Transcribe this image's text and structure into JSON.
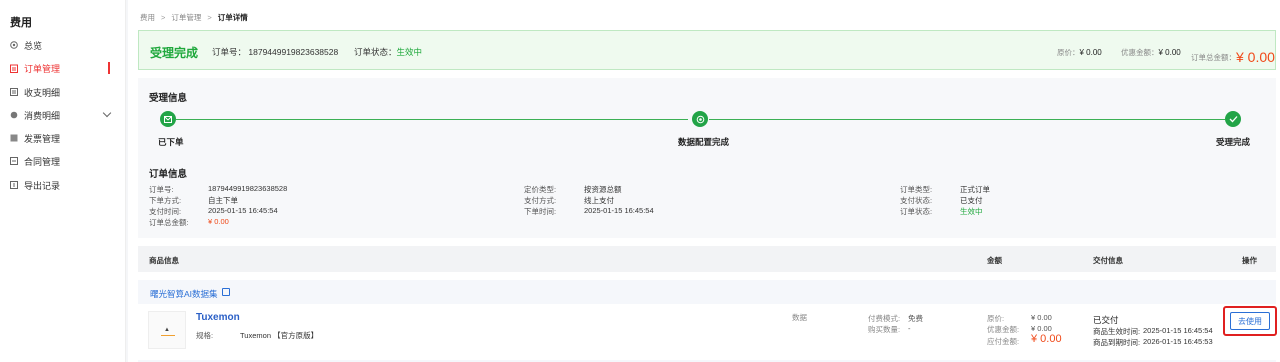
{
  "sidebar": {
    "title": "费用",
    "items": [
      {
        "label": "总览",
        "icon": "overview-icon"
      },
      {
        "label": "订单管理",
        "icon": "order-icon",
        "active": true
      },
      {
        "label": "收支明细",
        "icon": "ledger-icon"
      },
      {
        "label": "消费明细",
        "icon": "consumption-icon",
        "expandable": true
      },
      {
        "label": "发票管理",
        "icon": "invoice-icon"
      },
      {
        "label": "合同管理",
        "icon": "contract-icon"
      },
      {
        "label": "导出记录",
        "icon": "export-icon"
      }
    ]
  },
  "breadcrumb": [
    "费用",
    "订单管理",
    "订单详情"
  ],
  "banner": {
    "status_title": "受理完成",
    "order_no_label": "订单号：",
    "order_no": "1879449919823638528",
    "order_status_label": "订单状态：",
    "order_status": "生效中",
    "original_price_label": "原价：",
    "original_price": "¥ 0.00",
    "discount_label": "优惠金额：",
    "discount": "¥ 0.00",
    "total_label": "订单总金额：",
    "total": "¥ 0.00"
  },
  "accept_info": {
    "title": "受理信息",
    "steps": [
      {
        "label": "已下单",
        "icon": "order-placed-icon"
      },
      {
        "label": "数据配置完成",
        "icon": "data-config-icon"
      },
      {
        "label": "受理完成",
        "icon": "check-icon"
      }
    ]
  },
  "order_info": {
    "title": "订单信息",
    "col1": [
      {
        "k": "订单号:",
        "v": "1879449919823638528"
      },
      {
        "k": "下单方式:",
        "v": "自主下单"
      },
      {
        "k": "支付时间:",
        "v": "2025-01-15 16:45:54"
      },
      {
        "k": "订单总金额:",
        "v": "¥ 0.00"
      }
    ],
    "col2": [
      {
        "k": "定价类型:",
        "v": "按资源总额"
      },
      {
        "k": "支付方式:",
        "v": "线上支付"
      },
      {
        "k": "下单时间:",
        "v": "2025-01-15 16:45:54"
      }
    ],
    "col3": [
      {
        "k": "订单类型:",
        "v": "正式订单"
      },
      {
        "k": "支付状态:",
        "v": "已支付"
      },
      {
        "k": "订单状态:",
        "v": "生效中"
      }
    ]
  },
  "table": {
    "headers": {
      "product": "商品信息",
      "amount": "金额",
      "delivery": "交付信息",
      "action": "操作"
    },
    "group": "曙光智算AI数据集",
    "product": {
      "thumb_text": "▲",
      "name": "Tuxemon",
      "spec_label": "规格:",
      "spec": "Tuxemon 【官方原版】",
      "category": "数据",
      "billing_label": "付费模式:",
      "billing": "免费",
      "qty_label": "购买数量:",
      "qty": "-",
      "orig_label": "原价:",
      "orig": "¥ 0.00",
      "disc_label": "优惠金额:",
      "disc": "¥ 0.00",
      "pay_label": "应付金额:",
      "pay": "¥ 0.00",
      "delivery_status": "已交付",
      "effective_label": "商品生效时间:",
      "effective": "2025-01-15 16:45:54",
      "expire_label": "商品到期时间:",
      "expire": "2026-01-15 16:45:53",
      "action": "去使用"
    }
  }
}
